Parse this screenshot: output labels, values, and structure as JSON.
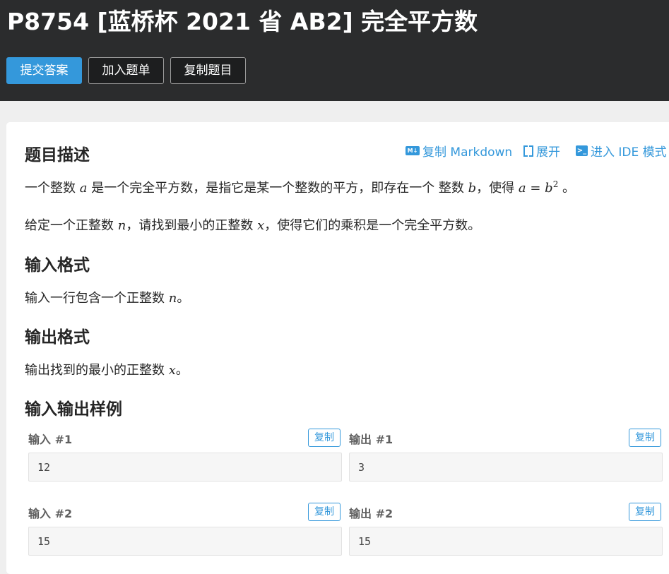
{
  "header": {
    "title": "P8754 [蓝桥杯 2021 省 AB2] 完全平方数",
    "submit_label": "提交答案",
    "add_label": "加入题单",
    "copy_label": "复制题目"
  },
  "toolbar": {
    "markdown_label": "复制 Markdown",
    "expand_label": "展开",
    "ide_label": "进入 IDE 模式"
  },
  "description": {
    "heading": "题目描述",
    "p1_a": "一个整数 ",
    "p1_var_a": "a",
    "p1_b": " 是一个完全平方数，是指它是某一个整数的平方，即存在一个 整数 ",
    "p1_var_b": "b",
    "p1_c": "，使得 ",
    "p1_eq": "a = b",
    "p1_exp": "2",
    "p1_d": " 。",
    "p2_a": "给定一个正整数 ",
    "p2_var_n": "n",
    "p2_b": "，请找到最小的正整数 ",
    "p2_var_x": "x",
    "p2_c": "，使得它们的乘积是一个完全平方数。"
  },
  "input_format": {
    "heading": "输入格式",
    "text_a": "输入一行包含一个正整数 ",
    "var": "n",
    "text_b": "。"
  },
  "output_format": {
    "heading": "输出格式",
    "text_a": "输出找到的最小的正整数 ",
    "var": "x",
    "text_b": "。"
  },
  "samples": {
    "heading": "输入输出样例",
    "copy_label": "复制",
    "items": [
      {
        "in_label": "输入 #1",
        "out_label": "输出 #1",
        "input": "12",
        "output": "3"
      },
      {
        "in_label": "输入 #2",
        "out_label": "输出 #2",
        "input": "15",
        "output": "15"
      }
    ]
  },
  "colors": {
    "accent": "#3498db",
    "header_bg": "#2b2c2d"
  }
}
